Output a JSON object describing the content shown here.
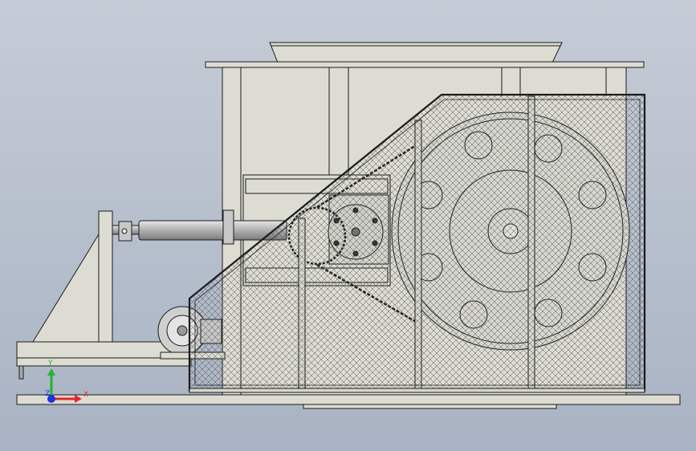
{
  "viewport": {
    "background_top": "#c5ccd7",
    "background_bottom": "#a9b3c3"
  },
  "model": {
    "body_color": "#dcdcd2",
    "line_color": "#1b1b1b",
    "mesh_color": "#505050",
    "cylinder_color": "#b9b9b9"
  },
  "triad": {
    "x_label": "X",
    "y_label": "Y",
    "z_label": "Z",
    "x_color": "#e3262e",
    "y_color": "#21b331",
    "z_color": "#1d34e0"
  }
}
